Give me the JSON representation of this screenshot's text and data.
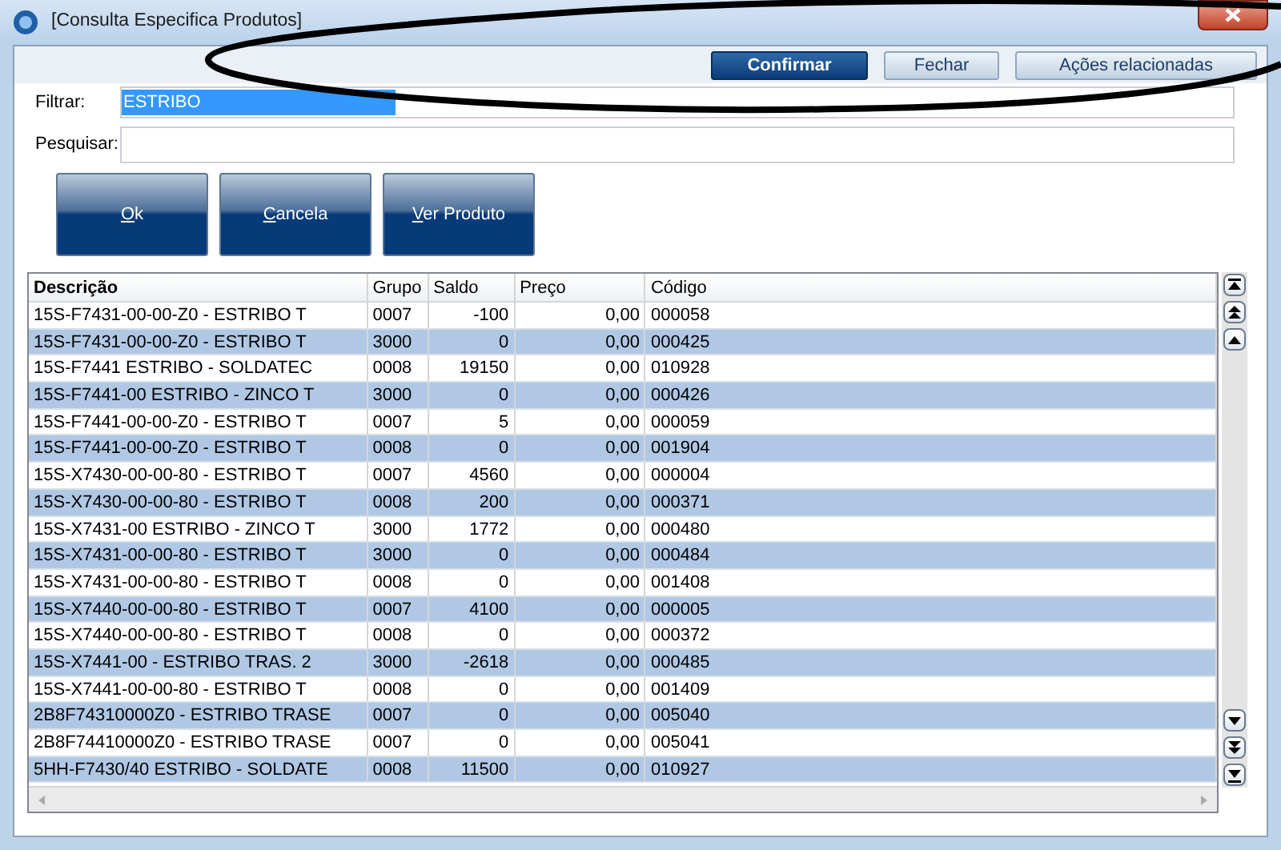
{
  "window": {
    "title": "[Consulta Especifica Produtos]"
  },
  "toolbar": [
    {
      "label": "Confirmar",
      "kind": "primary"
    },
    {
      "label": "Fechar",
      "kind": "secondary"
    },
    {
      "label": "Ações relacionadas",
      "kind": "secondary"
    }
  ],
  "filter": {
    "label": "Filtrar:",
    "value": "ESTRIBO",
    "value_highlighted": true
  },
  "search": {
    "label": "Pesquisar:"
  },
  "actions": [
    {
      "label": "Ok",
      "mnemonic": true
    },
    {
      "label": "Cancela",
      "mnemonic": true
    },
    {
      "label": "Ver Produto",
      "mnemonic": true
    }
  ],
  "table": {
    "columns": [
      {
        "label": "Descrição",
        "kind": "text"
      },
      {
        "label": "Grupo",
        "kind": "text"
      },
      {
        "label": "Saldo",
        "kind": "number"
      },
      {
        "label": "Preço",
        "kind": "number"
      },
      {
        "label": "Código",
        "kind": "text"
      }
    ],
    "rows": [
      [
        "15S-F7431-00-00-Z0 - ESTRIBO T",
        "0007",
        "-100",
        "0,00",
        "000058"
      ],
      [
        "15S-F7431-00-00-Z0 - ESTRIBO T",
        "3000",
        "0",
        "0,00",
        "000425"
      ],
      [
        "15S-F7441 ESTRIBO - SOLDATEC",
        "0008",
        "19150",
        "0,00",
        "010928"
      ],
      [
        "15S-F7441-00 ESTRIBO - ZINCO T",
        "3000",
        "0",
        "0,00",
        "000426"
      ],
      [
        "15S-F7441-00-00-Z0 - ESTRIBO T",
        "0007",
        "5",
        "0,00",
        "000059"
      ],
      [
        "15S-F7441-00-00-Z0 - ESTRIBO T",
        "0008",
        "0",
        "0,00",
        "001904"
      ],
      [
        "15S-X7430-00-00-80 - ESTRIBO T",
        "0007",
        "4560",
        "0,00",
        "000004"
      ],
      [
        "15S-X7430-00-00-80 - ESTRIBO T",
        "0008",
        "200",
        "0,00",
        "000371"
      ],
      [
        "15S-X7431-00 ESTRIBO - ZINCO T",
        "3000",
        "1772",
        "0,00",
        "000480"
      ],
      [
        "15S-X7431-00-00-80 - ESTRIBO T",
        "3000",
        "0",
        "0,00",
        "000484"
      ],
      [
        "15S-X7431-00-00-80 - ESTRIBO T",
        "0008",
        "0",
        "0,00",
        "001408"
      ],
      [
        "15S-X7440-00-00-80 - ESTRIBO T",
        "0007",
        "4100",
        "0,00",
        "000005"
      ],
      [
        "15S-X7440-00-00-80 - ESTRIBO T",
        "0008",
        "0",
        "0,00",
        "000372"
      ],
      [
        "15S-X7441-00 - ESTRIBO TRAS. 2",
        "3000",
        "-2618",
        "0,00",
        "000485"
      ],
      [
        "15S-X7441-00-00-80 - ESTRIBO T",
        "0008",
        "0",
        "0,00",
        "001409"
      ],
      [
        "2B8F74310000Z0 - ESTRIBO TRASE",
        "0007",
        "0",
        "0,00",
        "005040"
      ],
      [
        "2B8F74410000Z0 - ESTRIBO TRASE",
        "0007",
        "0",
        "0,00",
        "005041"
      ],
      [
        "5HH-F7430/40 ESTRIBO - SOLDATE",
        "0008",
        "11500",
        "0,00",
        "010927"
      ]
    ]
  }
}
